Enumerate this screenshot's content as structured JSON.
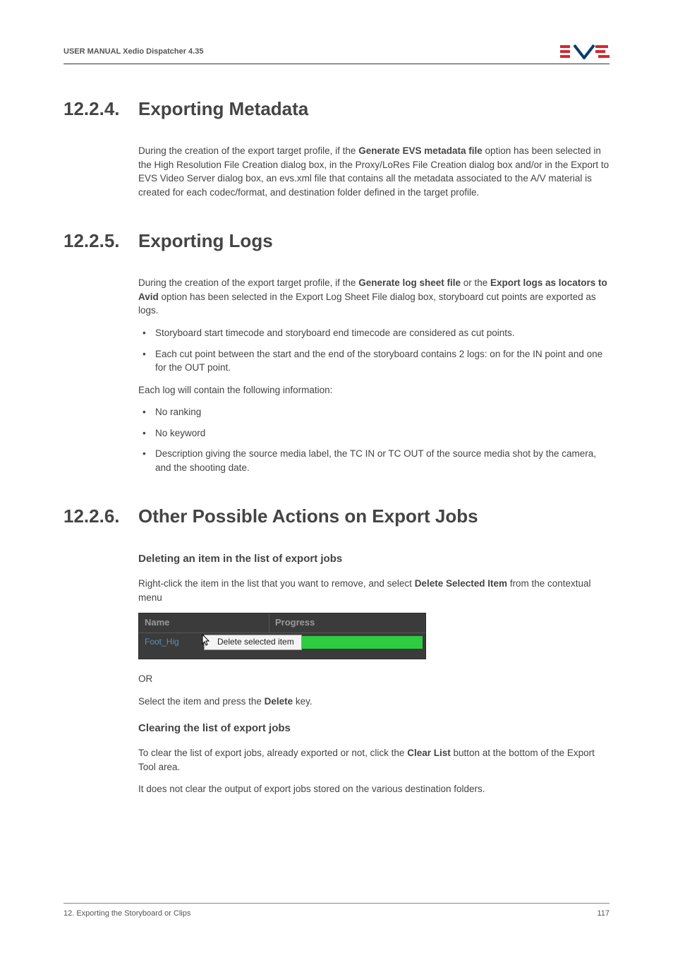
{
  "header": {
    "title": "USER MANUAL Xedio Dispatcher 4.35"
  },
  "sections": [
    {
      "num": "12.2.4.",
      "title": "Exporting Metadata",
      "para1_pre": "During the creation of the export target profile, if the ",
      "para1_bold": "Generate EVS metadata file",
      "para1_post": " option has been selected in the High Resolution File Creation dialog box, in the Proxy/LoRes File Creation dialog box and/or in the Export to EVS Video Server dialog box, an evs.xml file that contains all the metadata associated to the A/V material is created for each codec/format, and destination folder defined in the target profile."
    },
    {
      "num": "12.2.5.",
      "title": "Exporting Logs",
      "para1_pre": "During the creation of the export target profile, if the ",
      "para1_bold1": "Generate log sheet file",
      "para1_mid": " or the ",
      "para1_bold2": "Export logs as locators to Avid",
      "para1_post": " option has been selected in the Export Log Sheet File dialog box, storyboard cut points are exported as logs.",
      "bullets1": [
        "Storyboard start timecode and storyboard end timecode are considered as cut points.",
        "Each cut point between the start and the end of the storyboard contains 2 logs: on for the IN point and one for the OUT point."
      ],
      "para2": "Each log will contain the following information:",
      "bullets2": [
        "No ranking",
        "No keyword",
        "Description giving the source media label, the TC IN or TC OUT of the source media shot by the camera, and the shooting date."
      ]
    },
    {
      "num": "12.2.6.",
      "title": "Other Possible Actions on Export Jobs",
      "sub1": "Deleting an item in the list of export jobs",
      "sub1_para_pre": "Right-click the item in the list that you want to remove, and select ",
      "sub1_para_bold": "Delete Selected Item",
      "sub1_para_post": " from the contextual menu",
      "screenshot": {
        "header_name": "Name",
        "header_progress": "Progress",
        "row_label": "Foot_Hig",
        "menu_item": "Delete selected item"
      },
      "or_label": "OR",
      "sub1_para2_pre": "Select the item and press the ",
      "sub1_para2_bold": "Delete",
      "sub1_para2_post": " key.",
      "sub2": "Clearing the list of export jobs",
      "sub2_para1_pre": "To clear the list of export jobs, already exported or not, click the ",
      "sub2_para1_bold": "Clear List",
      "sub2_para1_post": " button at the bottom of the Export Tool area.",
      "sub2_para2": "It does not clear the output of export jobs stored on the various destination folders."
    }
  ],
  "footer": {
    "left": "12. Exporting the Storyboard or Clips",
    "right": "117"
  }
}
